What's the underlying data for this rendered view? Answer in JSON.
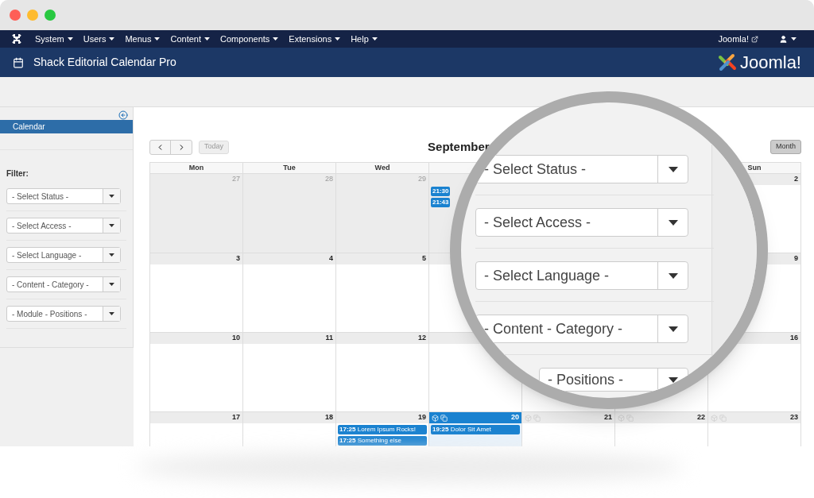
{
  "window": {
    "controls": [
      {
        "color": "#fe5f57"
      },
      {
        "color": "#febb2e"
      },
      {
        "color": "#28c840"
      }
    ]
  },
  "menu_bar": {
    "items": [
      "System",
      "Users",
      "Menus",
      "Content",
      "Components",
      "Extensions",
      "Help"
    ],
    "site_link": "Joomla!"
  },
  "header": {
    "title": "Shack Editorial Calendar Pro",
    "logo_text": "Joomla!"
  },
  "sidebar": {
    "items": [
      {
        "label": "Calendar",
        "selected": true
      }
    ],
    "filter_label": "Filter:",
    "filters": [
      "- Select Status -",
      "- Select Access -",
      "- Select Language -",
      "- Content - Category -",
      "- Module - Positions -"
    ]
  },
  "calendar": {
    "title": "September",
    "today_button": "Today",
    "view_button": "Month",
    "columns": [
      {
        "label": "Mon"
      },
      {
        "label": "Tue"
      },
      {
        "label": "Wed"
      },
      {},
      {},
      {},
      {
        "label": "Sun"
      }
    ],
    "weeks": [
      {
        "cells": [
          {
            "day": "27",
            "outside": true
          },
          {
            "day": "28",
            "outside": true
          },
          {
            "day": "29",
            "outside": true
          },
          {
            "outside": true,
            "events": [
              {
                "time": "21:30"
              },
              {
                "time": "21:43"
              }
            ]
          },
          {},
          {},
          {
            "day": "2",
            "outside": false
          }
        ]
      },
      {
        "cells": [
          {
            "day": "3",
            "outside": false
          },
          {
            "day": "4",
            "outside": false
          },
          {
            "day": "5",
            "outside": false
          },
          {},
          {},
          {},
          {
            "day": "9",
            "outside": false
          }
        ]
      },
      {
        "cells": [
          {
            "day": "10",
            "outside": false
          },
          {
            "day": "11",
            "outside": false
          },
          {
            "day": "12",
            "outside": false
          },
          {},
          {},
          {},
          {
            "day": "16",
            "outside": false
          }
        ]
      },
      {
        "cells": [
          {
            "day": "17",
            "outside": false
          },
          {
            "day": "18",
            "outside": false
          },
          {
            "day": "19",
            "outside": false,
            "events": [
              {
                "time": "17:25",
                "title": "Lorem Ipsum Rocks!"
              },
              {
                "time": "17:25",
                "title": "Something else"
              }
            ]
          },
          {
            "day": "20",
            "outside": false,
            "today": true,
            "tools": true,
            "events": [
              {
                "time": "19:25",
                "title": "Dolor Sit Amet"
              }
            ]
          },
          {
            "day": "21",
            "outside": false,
            "tools": true
          },
          {
            "day": "22",
            "outside": false,
            "tools": true
          },
          {
            "day": "23",
            "outside": false,
            "tools": true
          }
        ]
      }
    ]
  },
  "magnifier": {
    "filters": [
      "- Select Status -",
      "- Select Access -",
      "- Select Language -",
      "- Content - Category -",
      "- Positions -"
    ]
  }
}
